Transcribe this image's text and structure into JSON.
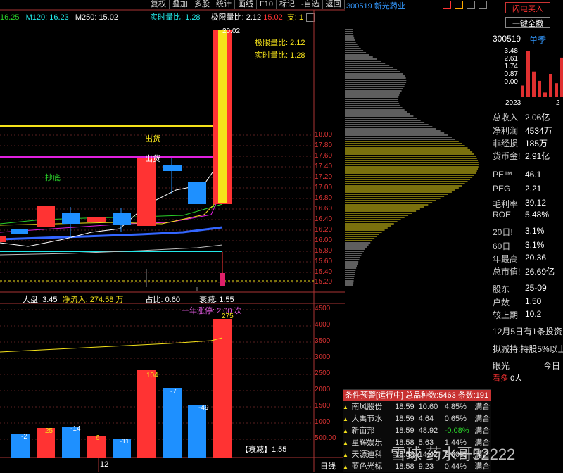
{
  "toolbar": {
    "items": [
      "复权",
      "叠加",
      "多股",
      "统计",
      "画线",
      "F10",
      "标记",
      "-自选",
      "返回"
    ]
  },
  "ma_legend": {
    "ma1": "16.25",
    "ma120": "M120: 16.23",
    "ma250": "M250: 15.02"
  },
  "realtime_ratio_top": "实时量比: 1.28",
  "limit_ratio_top": "极限量比: 2.12",
  "price_top_right": "15.02",
  "support_label": "支: 1",
  "price_axis": [
    "18.00",
    "17.80",
    "17.60",
    "17.40",
    "17.20",
    "17.00",
    "16.80",
    "16.60",
    "16.40",
    "16.20",
    "16.00",
    "15.80",
    "15.60",
    "15.40",
    "15.20"
  ],
  "price_label_high": "20.02",
  "overlay_limit_ratio": "极限量比: 2.12",
  "overlay_realtime_ratio": "实时量比: 1.28",
  "signals": {
    "sell1": "出货",
    "sell2": "出货",
    "bottom": "抄底"
  },
  "mid_bar": {
    "dapan": "大盘: 3.45",
    "inflow": "净流入: 274.58 万",
    "ratio": "占比: 0.60",
    "decline": "衰减: 1.55"
  },
  "vol_axis": [
    "4500",
    "4000",
    "3500",
    "3000",
    "2500",
    "2000",
    "1500",
    "1000",
    "500.00"
  ],
  "limit_up_count": "一年涨停: 2.00 次",
  "vol_labels": [
    "-2",
    "25",
    "-14",
    "6",
    "-11",
    "104",
    "-7",
    "-49",
    "275"
  ],
  "vol_bottom_label": "【衰减】1.55",
  "period_label": "日线",
  "bottom_num": "12",
  "stock_header": "300519 新光药业",
  "right_panel": {
    "flash_buy": "闪电买入",
    "one_key_cancel": "一键全撤",
    "code": "300519",
    "mode": "单季",
    "chart_y": [
      "3.48",
      "2.61",
      "1.74",
      "0.87",
      "0.00"
    ],
    "chart_x": [
      "2023",
      "2"
    ],
    "chart_bars": [
      0.25,
      1.0,
      0.55,
      0.35,
      0.1,
      0.5,
      0.3,
      0.85
    ],
    "fund_rows": [
      {
        "label": "总收入",
        "value": "2.06亿"
      },
      {
        "label": "净利润",
        "value": "4534万"
      },
      {
        "label": "非经损",
        "value": "185万"
      },
      {
        "label": "货币金!",
        "value": "2.91亿"
      },
      {
        "label": "PE™",
        "value": "46.1"
      },
      {
        "label": "PEG",
        "value": "2.21"
      },
      {
        "label": "毛利率",
        "value": "39.12"
      },
      {
        "label": "ROE",
        "value": "5.48%"
      },
      {
        "label": "20日!",
        "value": "3.1%"
      },
      {
        "label": "60日",
        "value": "3.1%"
      },
      {
        "label": "年最高",
        "value": "20.36"
      },
      {
        "label": "总市值!",
        "value": "26.69亿"
      },
      {
        "label": "股东",
        "value": "25-09"
      },
      {
        "label": "户数",
        "value": "1.50"
      },
      {
        "label": "较上期",
        "value": "10.2"
      }
    ],
    "news1": "12月5日有1条投资",
    "news2": "拟减持:持股5%以上",
    "eye_label": "眼光",
    "today_label": "今日",
    "bullish": "看多",
    "bullish_count": "0人"
  },
  "alert": {
    "header": "条件预警[运行中] 总品种数:5463 条数:191",
    "rows": [
      {
        "name": "南风股份",
        "time": "18:59",
        "price": "10.60",
        "pct": "4.85%",
        "note": "满合"
      },
      {
        "name": "大禹节水",
        "time": "18:59",
        "price": "4.64",
        "pct": "0.65%",
        "note": "满合"
      },
      {
        "name": "新亩邦",
        "time": "18:59",
        "price": "48.92",
        "pct": "-0.08%",
        "note": "满合"
      },
      {
        "name": "星辉娱乐",
        "time": "18:58",
        "price": "5.63",
        "pct": "1.44%",
        "note": "满合"
      },
      {
        "name": "天源迪科",
        "time": "18:58",
        "price": "14.42",
        "pct": "2.80%",
        "note": "满合"
      },
      {
        "name": "蓝色光标",
        "time": "18:58",
        "price": "9.23",
        "pct": "0.44%",
        "note": "满合"
      }
    ]
  },
  "watermark": "雪球 药水哥52222",
  "colors": {
    "up": "#ff3333",
    "down": "#1e90ff",
    "yellow": "#f5e21a",
    "magenta": "#e020e0",
    "cyan": "#22e8e8"
  }
}
